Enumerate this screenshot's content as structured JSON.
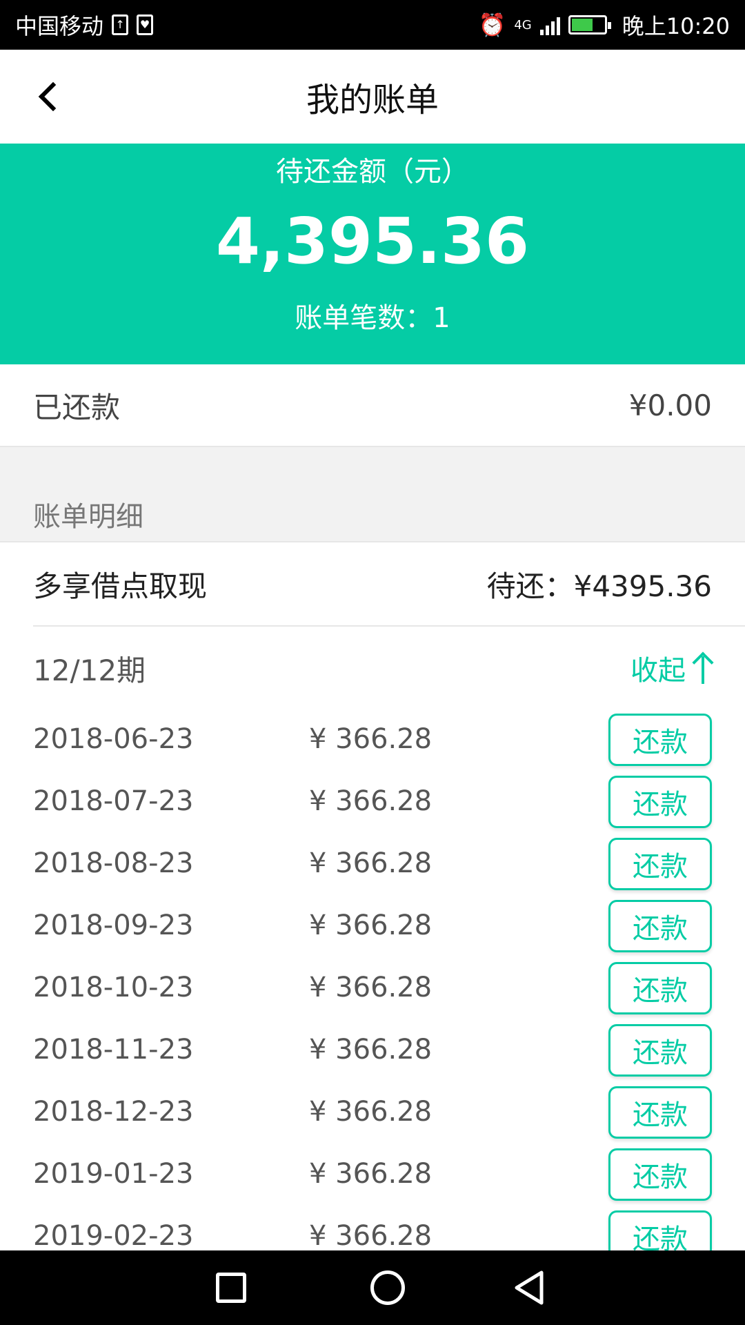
{
  "status_bar": {
    "carrier": "中国移动",
    "network": "4G",
    "time": "晚上10:20"
  },
  "header": {
    "title": "我的账单"
  },
  "summary": {
    "label": "待还金额（元）",
    "amount": "4,395.36",
    "count_text": "账单笔数：1"
  },
  "repaid": {
    "label": "已还款",
    "value": "¥0.00"
  },
  "details": {
    "title": "账单明细"
  },
  "loan": {
    "name": "多享借点取现",
    "due": "待还：¥4395.36"
  },
  "period": {
    "label": "12/12期",
    "collapse_label": "收起"
  },
  "installments": [
    {
      "date": "2018-06-23",
      "amount": "¥ 366.28",
      "button": "还款"
    },
    {
      "date": "2018-07-23",
      "amount": "¥ 366.28",
      "button": "还款"
    },
    {
      "date": "2018-08-23",
      "amount": "¥ 366.28",
      "button": "还款"
    },
    {
      "date": "2018-09-23",
      "amount": "¥ 366.28",
      "button": "还款"
    },
    {
      "date": "2018-10-23",
      "amount": "¥ 366.28",
      "button": "还款"
    },
    {
      "date": "2018-11-23",
      "amount": "¥ 366.28",
      "button": "还款"
    },
    {
      "date": "2018-12-23",
      "amount": "¥ 366.28",
      "button": "还款"
    },
    {
      "date": "2019-01-23",
      "amount": "¥ 366.28",
      "button": "还款"
    },
    {
      "date": "2019-02-23",
      "amount": "¥ 366.28",
      "button": "还款"
    }
  ],
  "colors": {
    "accent": "#05cca5",
    "status_bar": "#000000",
    "nav_bar": "#000000",
    "section_gray": "#f2f2f2"
  },
  "icons": {
    "back": "back-chevron-icon",
    "collapse": "arrow-up-icon",
    "nav_recent": "square-icon",
    "nav_home": "circle-icon",
    "nav_back": "triangle-back-icon"
  }
}
